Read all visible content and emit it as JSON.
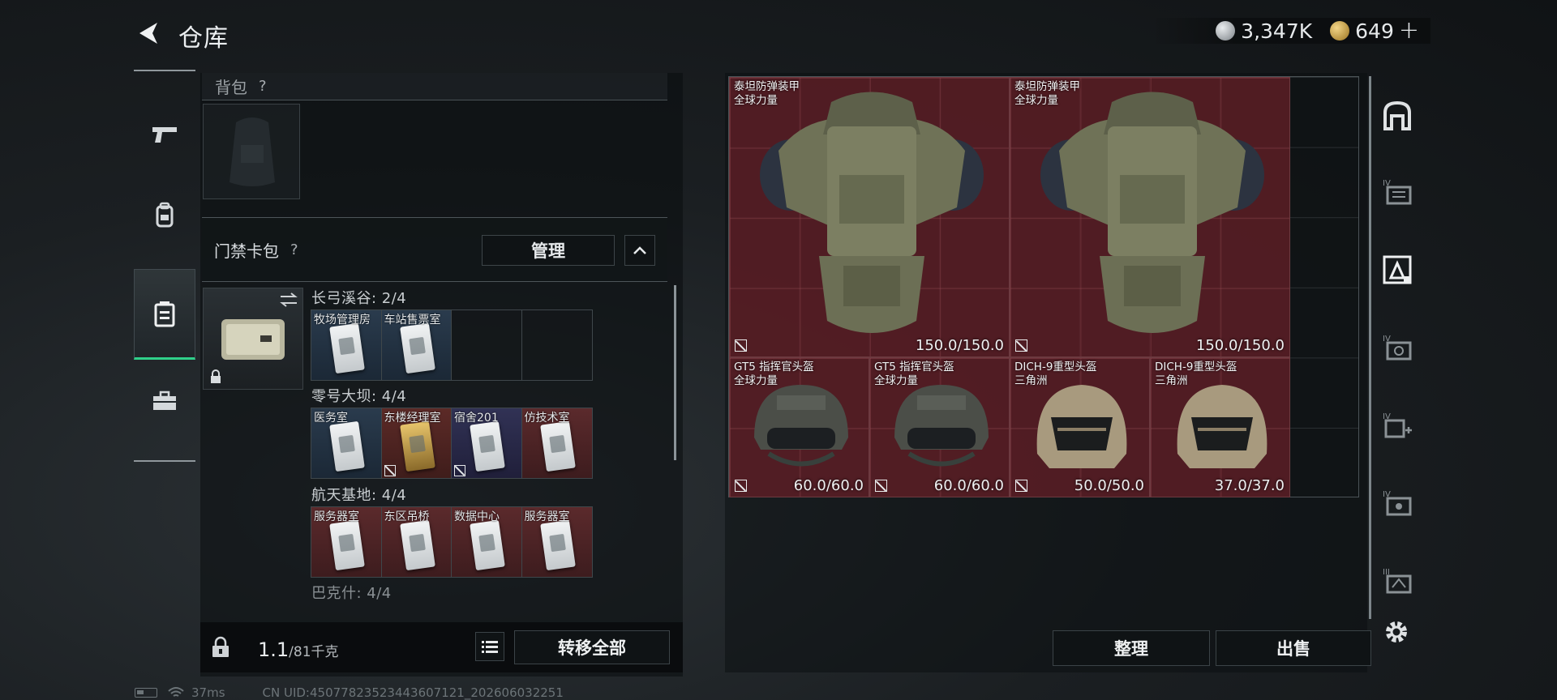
{
  "header": {
    "title": "仓库"
  },
  "currency": {
    "silver_value": "3,347K",
    "gold_value": "649",
    "add_label": "+"
  },
  "nav": {
    "items": [
      "weapons",
      "equipment",
      "storage",
      "toolbox"
    ],
    "active": "storage"
  },
  "backpack": {
    "label": "背包",
    "help": "?"
  },
  "keycard_case": {
    "title": "门禁卡包",
    "help": "?",
    "manage_label": "管理",
    "sections": [
      {
        "name": "长弓溪谷: 2/4",
        "cards": [
          {
            "name": "牧场管理房",
            "color": "blue"
          },
          {
            "name": "车站售票室",
            "color": "blue"
          },
          {
            "name": "",
            "color": "empty"
          },
          {
            "name": "",
            "color": "empty"
          }
        ]
      },
      {
        "name": "零号大坝: 4/4",
        "cards": [
          {
            "name": "医务室",
            "color": "blue"
          },
          {
            "name": "东楼经理室",
            "color": "gold"
          },
          {
            "name": "宿舍201",
            "color": "purple"
          },
          {
            "name": "仿技术室",
            "color": "red"
          }
        ]
      },
      {
        "name": "航天基地: 4/4",
        "cards": [
          {
            "name": "服务器室",
            "color": "red"
          },
          {
            "name": "东区吊桥",
            "color": "red"
          },
          {
            "name": "数据中心",
            "color": "red"
          },
          {
            "name": "服务器室",
            "color": "red"
          }
        ]
      },
      {
        "name": "巴克什: 4/4",
        "cards": []
      }
    ]
  },
  "footer": {
    "weight_current": "1.1",
    "weight_max": "/81千克",
    "transfer_all_label": "转移全部"
  },
  "items": [
    {
      "name1": "泰坦防弹装甲",
      "name2": "全球力量",
      "durability": "150.0/150.0",
      "type": "armor"
    },
    {
      "name1": "泰坦防弹装甲",
      "name2": "全球力量",
      "durability": "150.0/150.0",
      "type": "armor"
    },
    {
      "name1": "GT5 指挥官头盔",
      "name2": "全球力量",
      "durability": "60.0/60.0",
      "type": "helmet-dark"
    },
    {
      "name1": "GT5 指挥官头盔",
      "name2": "全球力量",
      "durability": "60.0/60.0",
      "type": "helmet-dark"
    },
    {
      "name1": "DICH-9重型头盔",
      "name2": "三角洲",
      "durability": "50.0/50.0",
      "type": "helmet-tan"
    },
    {
      "name1": "DICH-9重型头盔",
      "name2": "三角洲",
      "durability": "37.0/37.0",
      "type": "helmet-tan"
    }
  ],
  "actions": {
    "tidy_label": "整理",
    "sell_label": "出售"
  },
  "status_bar": {
    "ping": "37ms",
    "uid": "CN UID:450778235234436071​21_202606032251"
  },
  "colors": {
    "accent": "#2fd08a",
    "item_red": "#69202c",
    "card_blue": "#2a3b4d"
  }
}
